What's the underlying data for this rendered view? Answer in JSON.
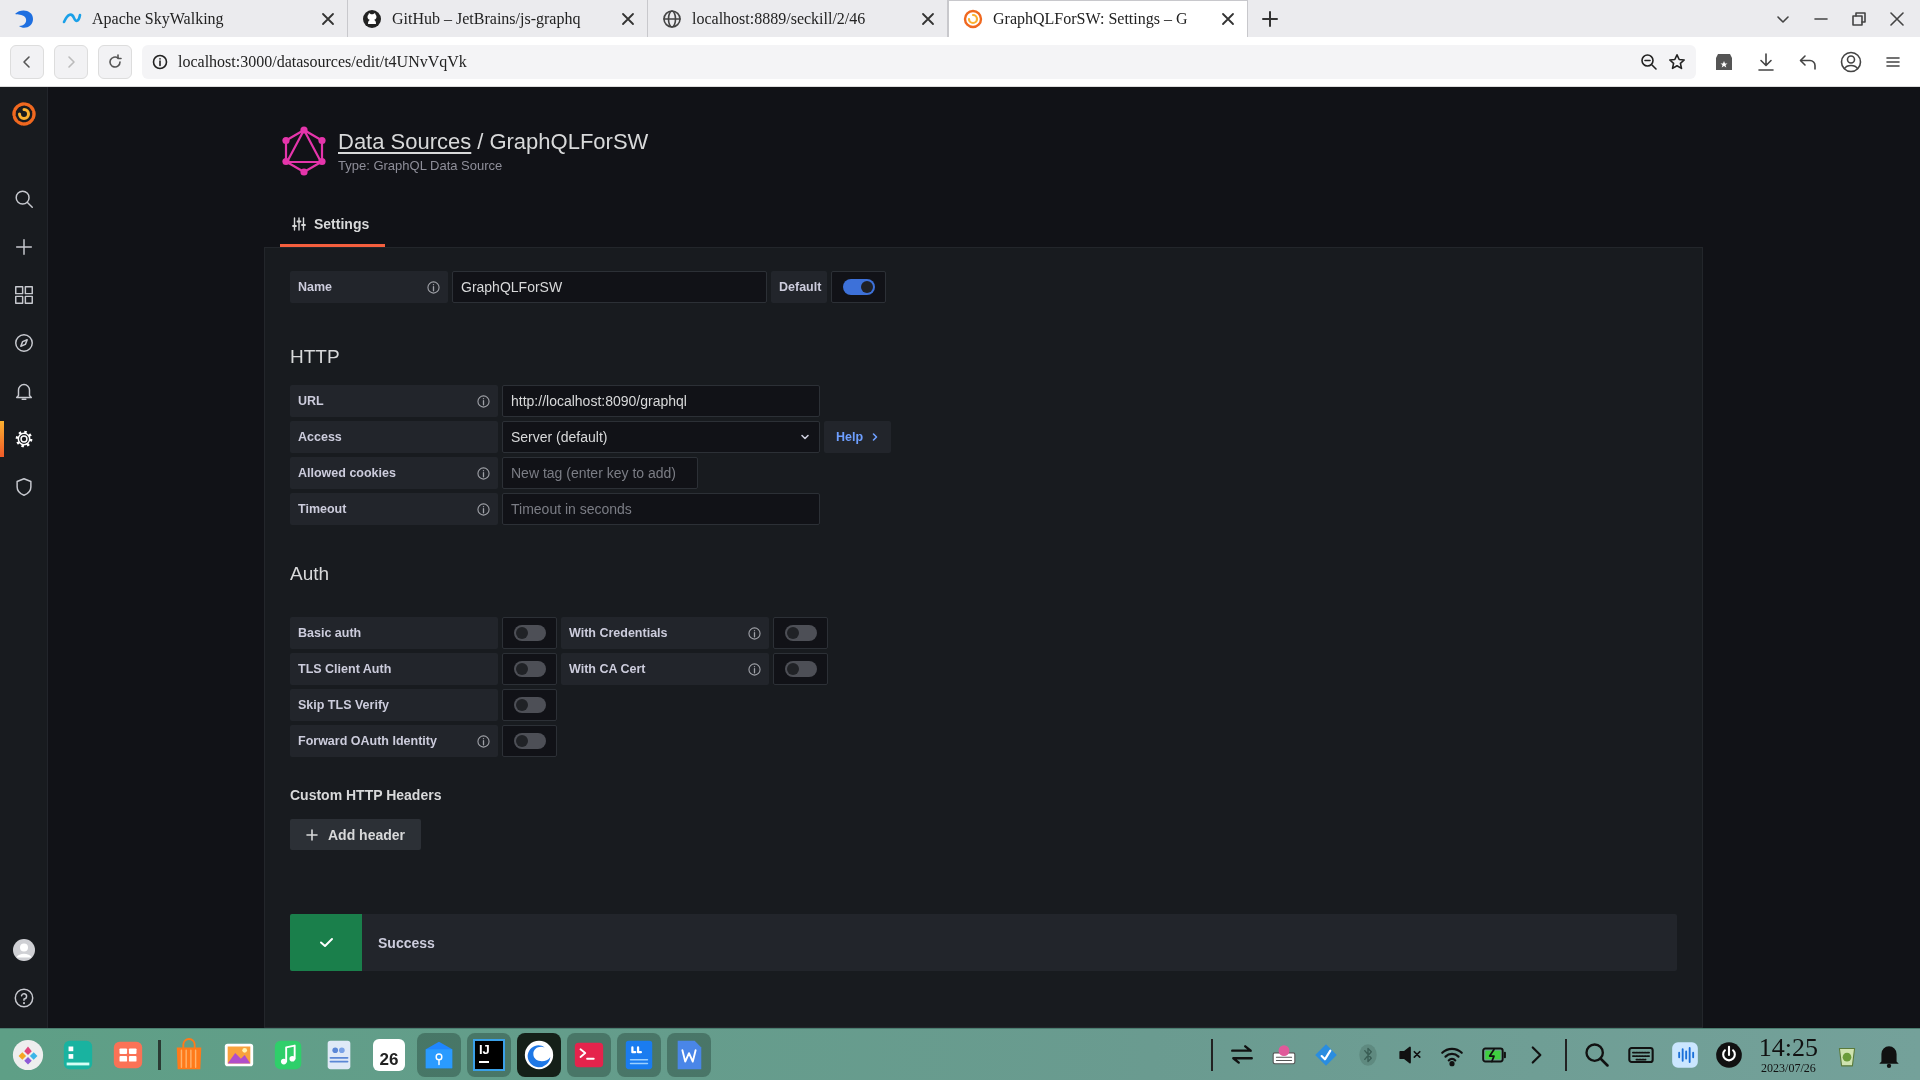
{
  "browser": {
    "tabs": [
      {
        "title": "Apache  SkyWalking",
        "kind": "skywalking",
        "selected": false
      },
      {
        "title": "GitHub – JetBrains/js-graphq",
        "kind": "github",
        "selected": false
      },
      {
        "title": "localhost:8889/seckill/2/46",
        "kind": "globe",
        "selected": false
      },
      {
        "title": "GraphQLForSW: Settings – G",
        "kind": "grafana",
        "selected": true
      }
    ],
    "url": "localhost:3000/datasources/edit/t4UNvVqVk"
  },
  "sidebar": {
    "items": [
      {
        "kind": "search",
        "selected": false
      },
      {
        "kind": "create",
        "selected": false
      },
      {
        "kind": "dashboards",
        "selected": false
      },
      {
        "kind": "explore",
        "selected": false
      },
      {
        "kind": "alerting",
        "selected": false
      },
      {
        "kind": "configuration",
        "selected": true
      },
      {
        "kind": "admin",
        "selected": false
      }
    ],
    "bottom": [
      {
        "kind": "profile"
      },
      {
        "kind": "help"
      }
    ]
  },
  "header": {
    "breadcrumb": "Data Sources",
    "separator": "/",
    "title": "GraphQLForSW",
    "subtitle": "Type: GraphQL Data Source"
  },
  "tabs": [
    {
      "label": "Settings",
      "selected": true
    }
  ],
  "name_field": {
    "label": "Name",
    "value": "GraphQLForSW",
    "default_label": "Default",
    "default_on": true
  },
  "http": {
    "heading": "HTTP",
    "fields": [
      {
        "kind": "text",
        "label": "URL",
        "info": true,
        "value": "http://localhost:8090/graphql"
      },
      {
        "kind": "select",
        "label": "Access",
        "info": false,
        "value": "Server (default)",
        "help": "Help"
      },
      {
        "kind": "tags",
        "label": "Allowed cookies",
        "info": true,
        "placeholder": "New tag (enter key to add)"
      },
      {
        "kind": "text",
        "label": "Timeout",
        "info": true,
        "placeholder": "Timeout in seconds"
      }
    ]
  },
  "auth": {
    "heading": "Auth",
    "rows": [
      {
        "label": "Basic auth",
        "info": false,
        "on": false,
        "extra": {
          "label": "With Credentials",
          "info": true,
          "on": false
        }
      },
      {
        "label": "TLS Client Auth",
        "info": false,
        "on": false,
        "extra": {
          "label": "With CA Cert",
          "info": true,
          "on": false
        }
      },
      {
        "label": "Skip TLS Verify",
        "info": false,
        "on": false
      },
      {
        "label": "Forward OAuth Identity",
        "info": true,
        "on": false
      }
    ]
  },
  "custom_headers": {
    "heading": "Custom HTTP Headers",
    "button": "Add header"
  },
  "alert": {
    "text": "Success"
  },
  "taskbar": {
    "apps": [
      {
        "kind": "launcher",
        "running": false
      },
      {
        "kind": "files",
        "running": false
      },
      {
        "kind": "multitask",
        "running": false
      },
      {
        "kind": "store",
        "running": false
      },
      {
        "kind": "photos",
        "running": false
      },
      {
        "kind": "music",
        "running": false
      },
      {
        "kind": "contacts",
        "running": false
      },
      {
        "kind": "calendar",
        "day": "26",
        "running": false
      },
      {
        "kind": "archive",
        "running": true
      },
      {
        "kind": "intellij",
        "label": "IJ",
        "running": true
      },
      {
        "kind": "browser",
        "running": true,
        "focused": true
      },
      {
        "kind": "terminal",
        "running": true
      },
      {
        "kind": "notes",
        "running": true
      },
      {
        "kind": "writer",
        "running": true
      }
    ],
    "clock": {
      "time": "14:25",
      "date": "2023/07/26"
    }
  }
}
